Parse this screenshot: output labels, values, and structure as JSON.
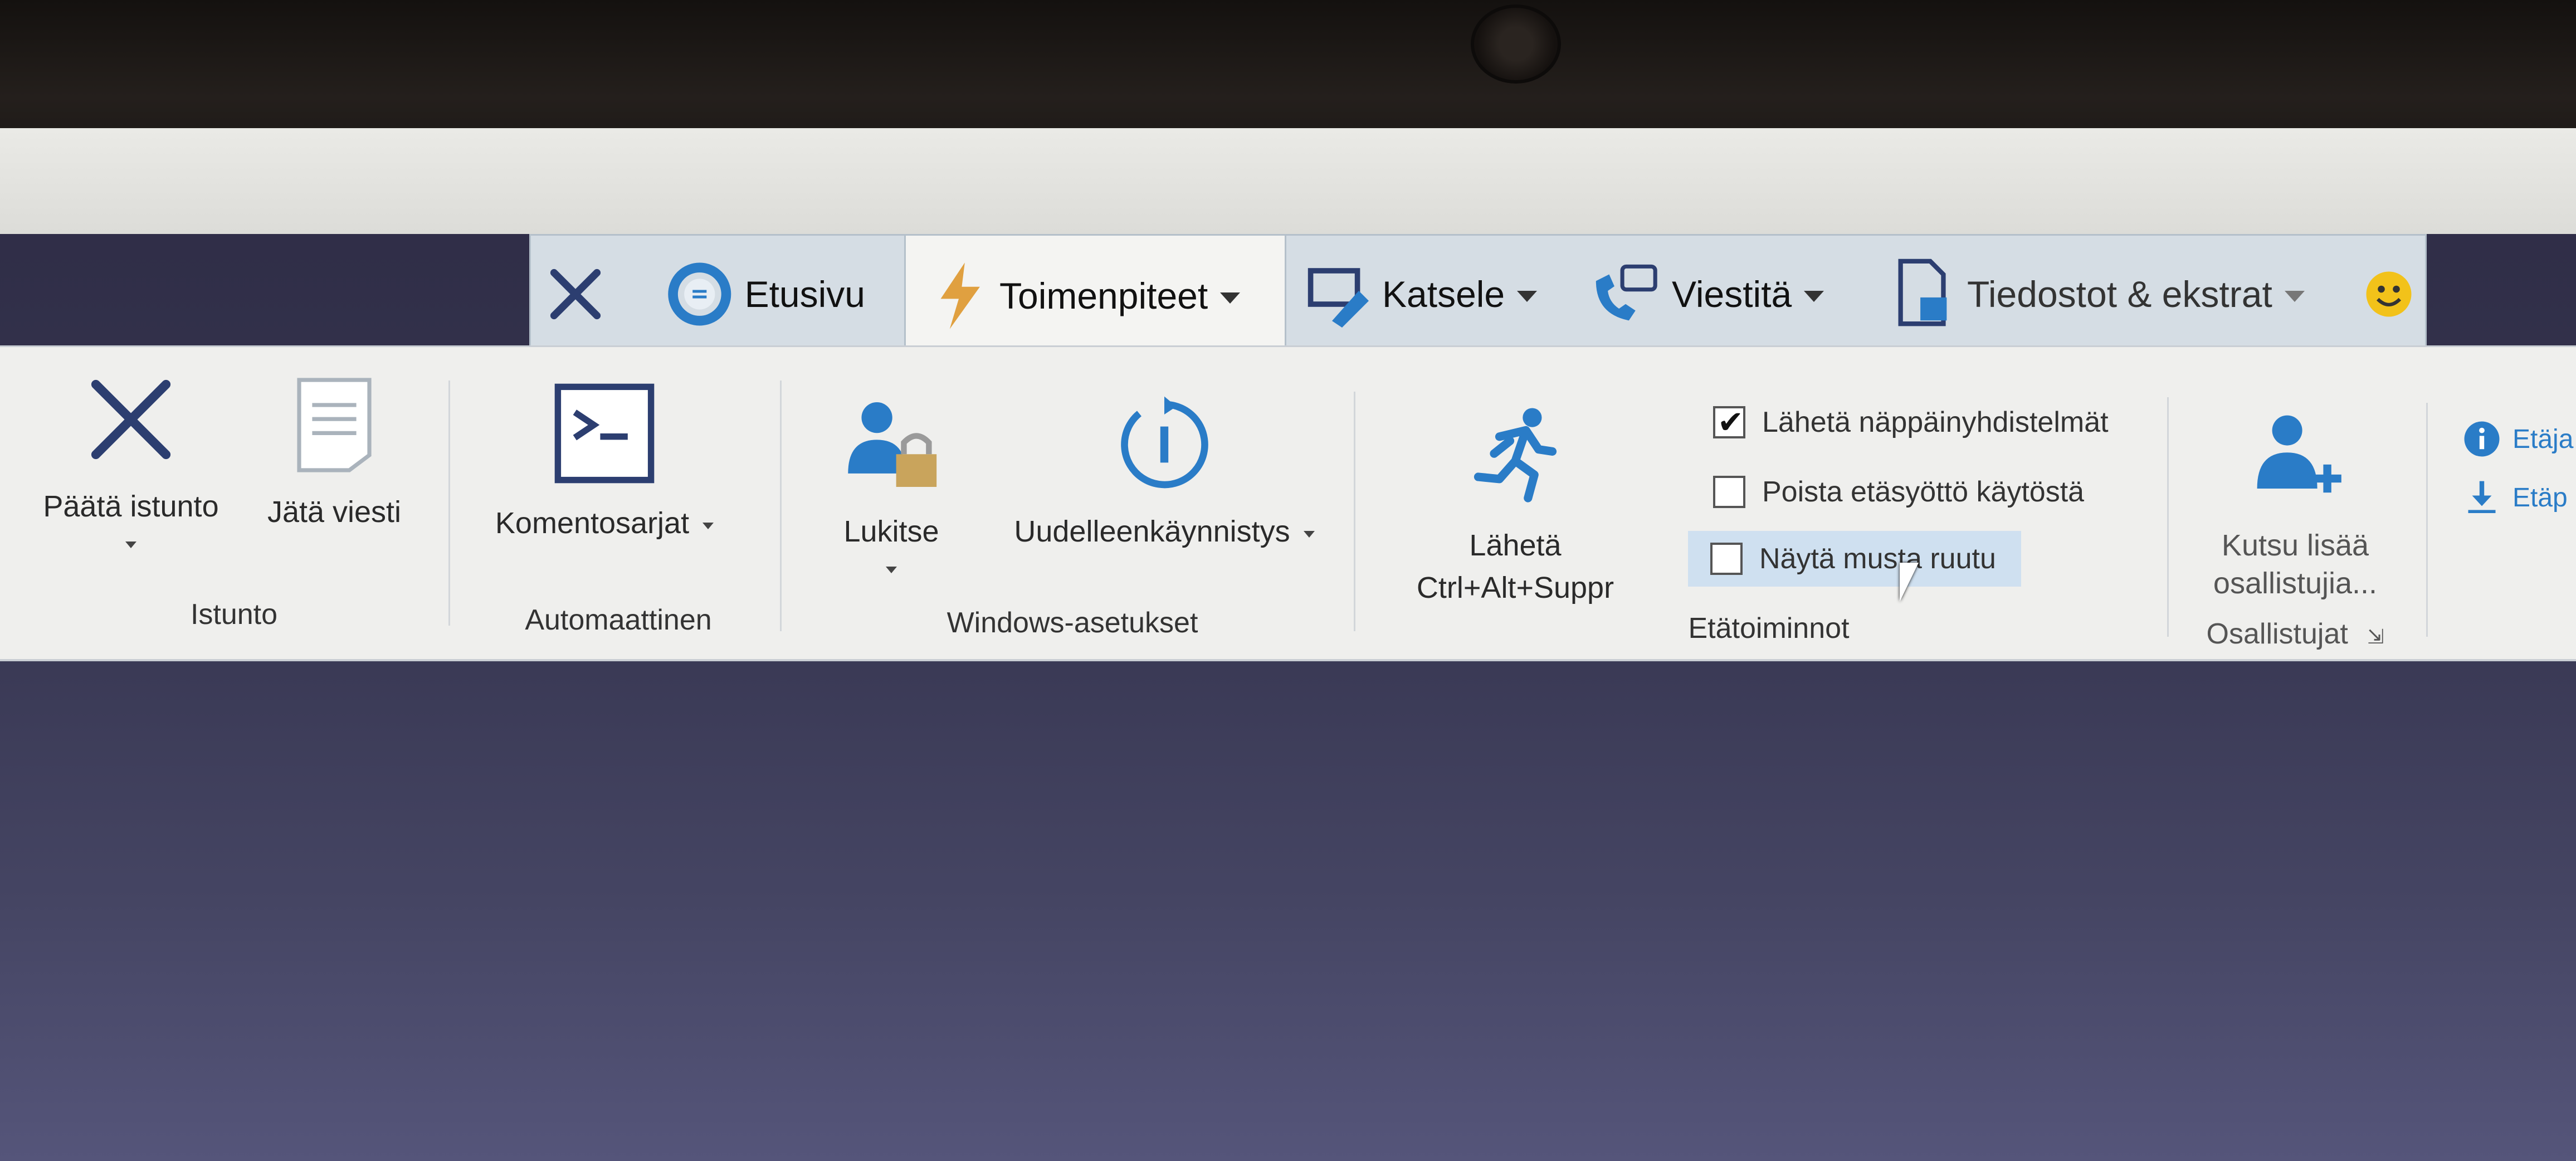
{
  "tabs": {
    "close": "close",
    "home": "Etusivu",
    "actions": "Toimenpiteet",
    "view": "Katsele",
    "communicate": "Viestitä",
    "files": "Tiedostot & ekstrat"
  },
  "ribbon": {
    "session": {
      "end_session": "Päätä istunto",
      "leave_message": "Jätä viesti",
      "group": "Istunto"
    },
    "automation": {
      "scripts": "Komentosarjat",
      "group": "Automaattinen"
    },
    "windows": {
      "lock": "Lukitse",
      "restart": "Uudelleenkäynnistys",
      "group": "Windows-asetukset"
    },
    "send_cad": {
      "line1": "Lähetä",
      "line2": "Ctrl+Alt+Suppr"
    },
    "remote": {
      "send_keys": "Lähetä näppäinyhdistelmät",
      "send_keys_checked": true,
      "disable_input": "Poista etäsyöttö käytöstä",
      "disable_input_checked": false,
      "black_screen": "Näytä musta ruutu",
      "black_screen_checked": false,
      "group": "Etätoiminnot"
    },
    "participants": {
      "invite_line1": "Kutsu lisää",
      "invite_line2": "osallistujia...",
      "group": "Osallistujat"
    },
    "extra": {
      "item1": "Etäja",
      "item2": "Etäp"
    }
  },
  "colors": {
    "accent": "#2a7cc7",
    "lock_gold": "#c9a45c",
    "dark_blue": "#2c3e70"
  },
  "icons": [
    "close-icon",
    "home-icon",
    "lightning-icon",
    "monitor-icon",
    "chat-phone-icon",
    "files-icon",
    "smiley-icon",
    "x-icon",
    "document-icon",
    "terminal-icon",
    "user-lock-icon",
    "restart-icon",
    "running-man-icon",
    "add-user-icon",
    "info-icon",
    "download-icon"
  ]
}
